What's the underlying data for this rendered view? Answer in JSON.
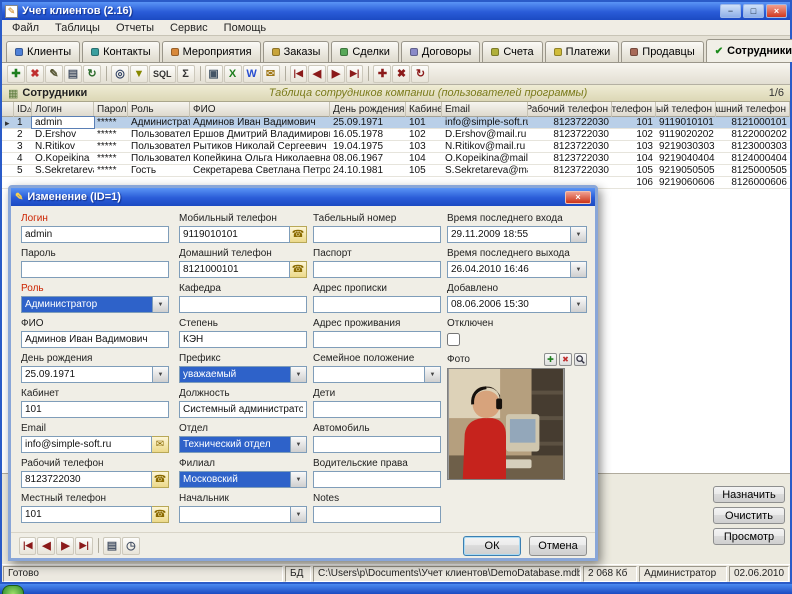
{
  "icons": {
    "pencil": "✎",
    "minimize": "−",
    "maximize": "□",
    "close": "×",
    "check": "✔",
    "sort_asc": "▵",
    "row_marker": "▸",
    "chevron_down": "▼",
    "phone": "☎",
    "mail": "✉",
    "plus": "✚",
    "cross": "✖",
    "table": "▦",
    "clock": "◷",
    "card": "▤"
  },
  "window": {
    "title": "Учет клиентов (2.16)"
  },
  "menu": [
    {
      "name": "menu-file",
      "label": "Файл"
    },
    {
      "name": "menu-tables",
      "label": "Таблицы"
    },
    {
      "name": "menu-reports",
      "label": "Отчеты"
    },
    {
      "name": "menu-service",
      "label": "Сервис"
    },
    {
      "name": "menu-help",
      "label": "Помощь"
    }
  ],
  "tabs": [
    {
      "name": "tab-clients",
      "label": "Клиенты",
      "icon_color": "#4f81d8"
    },
    {
      "name": "tab-contacts",
      "label": "Контакты",
      "icon_color": "#3a9f9f"
    },
    {
      "name": "tab-events",
      "label": "Мероприятия",
      "icon_color": "#d8893a"
    },
    {
      "name": "tab-orders",
      "label": "Заказы",
      "icon_color": "#c8a43a"
    },
    {
      "name": "tab-deals",
      "label": "Сделки",
      "icon_color": "#58a858"
    },
    {
      "name": "tab-contracts",
      "label": "Договоры",
      "icon_color": "#8a8ac8"
    },
    {
      "name": "tab-invoices",
      "label": "Счета",
      "icon_color": "#b0b03a"
    },
    {
      "name": "tab-payments",
      "label": "Платежи",
      "icon_color": "#d0bc3a"
    },
    {
      "name": "tab-sellers",
      "label": "Продавцы",
      "icon_color": "#a86a58"
    },
    {
      "name": "tab-employees",
      "label": "Сотрудники",
      "active": true,
      "check": true
    }
  ],
  "toolbar": [
    {
      "name": "add-record-icon",
      "glyph": "✚",
      "color": "#1e7e1e"
    },
    {
      "name": "delete-record-icon",
      "glyph": "✖",
      "color": "#c03030"
    },
    {
      "name": "edit-record-icon",
      "glyph": "✎",
      "color": "#555533"
    },
    {
      "name": "copy-record-icon",
      "glyph": "▤",
      "color": "#4a5568"
    },
    {
      "name": "refresh-icon",
      "glyph": "↻",
      "color": "#2a6a2a"
    },
    {
      "sep": true
    },
    {
      "name": "search-icon",
      "glyph": "◎",
      "color": "#334466"
    },
    {
      "name": "filter-icon",
      "glyph": "▼",
      "color": "#888800"
    },
    {
      "name": "sql-icon",
      "glyph": "SQL",
      "color": "#333333",
      "wide": true
    },
    {
      "name": "sum-icon",
      "glyph": "Σ",
      "color": "#333333"
    },
    {
      "sep": true
    },
    {
      "name": "print-icon",
      "glyph": "▣",
      "color": "#445566"
    },
    {
      "name": "export-excel-icon",
      "glyph": "X",
      "color": "#1e7e1e"
    },
    {
      "name": "export-word-icon",
      "glyph": "W",
      "color": "#2a4fd0"
    },
    {
      "name": "mail-icon",
      "glyph": "✉",
      "color": "#a07818"
    },
    {
      "sep": true
    },
    {
      "name": "first-record-icon",
      "glyph": "|◀",
      "color": "#8b1a1a",
      "wide": true
    },
    {
      "name": "prev-record-icon",
      "glyph": "◀",
      "color": "#8b1a1a"
    },
    {
      "name": "next-record-icon",
      "glyph": "▶",
      "color": "#8b1a1a"
    },
    {
      "name": "last-record-icon",
      "glyph": "▶|",
      "color": "#8b1a1a",
      "wide": true
    },
    {
      "sep": true
    },
    {
      "name": "insert-row-icon",
      "glyph": "✚",
      "color": "#8b1a1a"
    },
    {
      "name": "cancel-edit-icon",
      "glyph": "✖",
      "color": "#8b1a1a"
    },
    {
      "name": "refresh-data-icon",
      "glyph": "↻",
      "color": "#8b1a1a"
    }
  ],
  "section": {
    "title": "Сотрудники",
    "subtitle": "Таблица сотрудников компании (пользователей программы)",
    "counter": "1/6"
  },
  "table": {
    "columns": [
      {
        "label": "ID",
        "sort": true
      },
      {
        "label": "Логин"
      },
      {
        "label": "Пароль"
      },
      {
        "label": "Роль"
      },
      {
        "label": "ФИО"
      },
      {
        "label": "День рождения"
      },
      {
        "label": "Кабинет"
      },
      {
        "label": "Email"
      },
      {
        "label": "Рабочий телефон"
      },
      {
        "label": "Местный телефон"
      },
      {
        "label": "Мобильный телефон"
      },
      {
        "label": "Домашний телефон"
      }
    ],
    "rows": [
      {
        "selected": true,
        "cells": [
          "1",
          "admin",
          "*****",
          "Администратор",
          "Админов Иван Вадимович",
          "25.09.1971",
          "101",
          "info@simple-soft.ru",
          "8123722030",
          "101",
          "9119010101",
          "8121000101"
        ]
      },
      {
        "cells": [
          "2",
          "D.Ershov",
          "*****",
          "Пользователь",
          "Ершов Дмитрий Владимирович",
          "16.05.1978",
          "102",
          "D.Ershov@mail.ru",
          "8123722030",
          "102",
          "9119020202",
          "8122000202"
        ]
      },
      {
        "cells": [
          "3",
          "N.Ritikov",
          "*****",
          "Пользователь",
          "Рытиков Николай Сергеевич",
          "19.04.1975",
          "103",
          "N.Ritikov@mail.ru",
          "8123722030",
          "103",
          "9219030303",
          "8123000303"
        ]
      },
      {
        "cells": [
          "4",
          "O.Kopeikina",
          "*****",
          "Пользователь",
          "Копейкина Ольга Николаевна",
          "08.06.1967",
          "104",
          "O.Kopeikina@mail.ru",
          "8123722030",
          "104",
          "9219040404",
          "8124000404"
        ]
      },
      {
        "cells": [
          "5",
          "S.Sekretareva",
          "*****",
          "Гость",
          "Секретарева Светлана Петровна",
          "24.10.1981",
          "105",
          "S.Sekretareva@mail.ru",
          "8123722030",
          "105",
          "9219050505",
          "8125000505"
        ]
      },
      {
        "cells": [
          "",
          "",
          "",
          "",
          "",
          "",
          "",
          "",
          "",
          "106",
          "9219060606",
          "8126000606"
        ]
      }
    ]
  },
  "dialog": {
    "title": "Изменение (ID=1)",
    "col1": {
      "login": {
        "label": "Логин",
        "value": "admin"
      },
      "password": {
        "label": "Пароль",
        "value": ""
      },
      "role": {
        "label": "Роль",
        "value": "Администратор"
      },
      "fio": {
        "label": "ФИО",
        "value": "Админов Иван Вадимович"
      },
      "birthday": {
        "label": "День рождения",
        "value": "25.09.1971"
      },
      "cabinet": {
        "label": "Кабинет",
        "value": "101"
      },
      "email": {
        "label": "Email",
        "value": "info@simple-soft.ru"
      },
      "work_phone": {
        "label": "Рабочий телефон",
        "value": "8123722030"
      },
      "local_phone": {
        "label": "Местный телефон",
        "value": "101"
      }
    },
    "col2": {
      "mobile_phone": {
        "label": "Мобильный телефон",
        "value": "9119010101"
      },
      "home_phone": {
        "label": "Домашний телефон",
        "value": "8121000101"
      },
      "kafedra": {
        "label": "Кафедра",
        "value": ""
      },
      "degree": {
        "label": "Степень",
        "value": "КЭН"
      },
      "prefix": {
        "label": "Префикс",
        "value": "уважаемый"
      },
      "position": {
        "label": "Должность",
        "value": "Системный администратор"
      },
      "department": {
        "label": "Отдел",
        "value": "Технический отдел"
      },
      "branch": {
        "label": "Филиал",
        "value": "Московский"
      },
      "chief": {
        "label": "Начальник",
        "value": ""
      }
    },
    "col3": {
      "tab_number": {
        "label": "Табельный номер",
        "value": ""
      },
      "passport": {
        "label": "Паспорт",
        "value": ""
      },
      "reg_address": {
        "label": "Адрес прописки",
        "value": ""
      },
      "live_address": {
        "label": "Адрес проживания",
        "value": ""
      },
      "marital": {
        "label": "Семейное положение",
        "value": ""
      },
      "children": {
        "label": "Дети",
        "value": ""
      },
      "car": {
        "label": "Автомобиль",
        "value": ""
      },
      "driving_license": {
        "label": "Водительские права",
        "value": ""
      },
      "notes": {
        "label": "Notes",
        "value": ""
      }
    },
    "col4": {
      "last_login": {
        "label": "Время последнего входа",
        "value": "29.11.2009 18:55"
      },
      "last_logout": {
        "label": "Время последнего выхода",
        "value": "26.04.2010 16:46"
      },
      "added": {
        "label": "Добавлено",
        "value": "08.06.2006 15:30"
      },
      "disabled": {
        "label": "Отключен"
      },
      "photo": {
        "label": "Фото"
      }
    },
    "nav": [
      {
        "name": "dialog-first-record-icon",
        "glyph": "|◀",
        "color": "#8b1a1a",
        "wide": true
      },
      {
        "name": "dialog-prev-record-icon",
        "glyph": "◀",
        "color": "#8b1a1a"
      },
      {
        "name": "dialog-next-record-icon",
        "glyph": "▶",
        "color": "#8b1a1a"
      },
      {
        "name": "dialog-last-record-icon",
        "glyph": "▶|",
        "color": "#8b1a1a",
        "wide": true
      },
      {
        "sep": true
      },
      {
        "name": "dialog-card-icon",
        "glyph": "▤",
        "color": "#4a5568"
      },
      {
        "name": "dialog-clock-icon",
        "glyph": "◷",
        "color": "#4a5568"
      }
    ],
    "ok": "ОК",
    "cancel": "Отмена"
  },
  "side_buttons": [
    {
      "name": "assign-button",
      "label": "Назначить"
    },
    {
      "name": "clear-button",
      "label": "Очистить"
    },
    {
      "name": "view-button",
      "label": "Просмотр"
    }
  ],
  "statusbar": {
    "ready": "Готово",
    "db_label": "БД",
    "db_path": "C:\\Users\\p\\Documents\\Учет клиентов\\DemoDatabase.mdb",
    "db_size": "2 068 Кб",
    "user": "Администратор",
    "date": "02.06.2010"
  }
}
